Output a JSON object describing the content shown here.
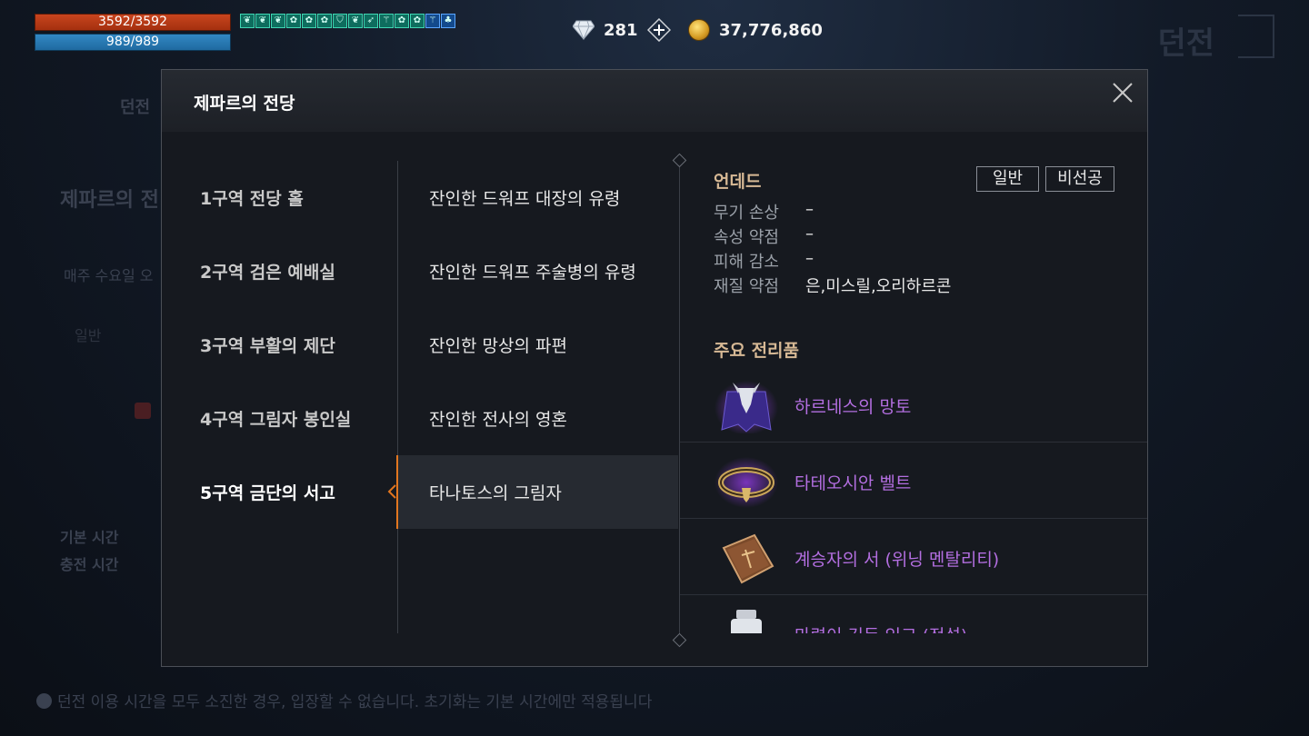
{
  "hud": {
    "hp": "3592/3592",
    "mp": "989/989",
    "buff_icons": [
      "leaf-icon",
      "leaf-icon",
      "leaf-icon",
      "flower-icon",
      "flower-icon",
      "flower-icon",
      "shield-icon",
      "leaf-icon",
      "feather-icon",
      "staff-icon",
      "flower-icon",
      "flower-icon",
      "staff-icon",
      "tree-icon"
    ]
  },
  "currency": {
    "gems": "281",
    "gold": "37,776,860"
  },
  "background": {
    "title": "던전",
    "dungeon_label": "던전",
    "sub_title": "제파르의 전",
    "weekly": "매주 수요일 오",
    "mode": "일반",
    "base_time": "기본 시간",
    "charge_time": "충전 시간",
    "note": "던전 이용 시간을 모두 소진한 경우, 입장할 수 없습니다. 초기화는 기본 시간에만 적용됩니다"
  },
  "modal": {
    "title": "제파르의 전당",
    "zones": [
      {
        "label": "1구역 전당 홀",
        "active": false
      },
      {
        "label": "2구역 검은 예배실",
        "active": false
      },
      {
        "label": "3구역 부활의 제단",
        "active": false
      },
      {
        "label": "4구역 그림자 봉인실",
        "active": false
      },
      {
        "label": "5구역 금단의 서고",
        "active": true
      }
    ],
    "bosses": [
      {
        "label": "잔인한 드워프 대장의 유령",
        "active": false
      },
      {
        "label": "잔인한 드워프 주술병의 유령",
        "active": false
      },
      {
        "label": "잔인한 망상의 파편",
        "active": false
      },
      {
        "label": "잔인한 전사의 영혼",
        "active": false
      },
      {
        "label": "타나토스의 그림자",
        "active": true
      }
    ],
    "detail": {
      "type": "언데드",
      "tags": [
        "일반",
        "비선공"
      ],
      "stats": [
        {
          "label": "무기 손상",
          "value": "–"
        },
        {
          "label": "속성 약점",
          "value": "–"
        },
        {
          "label": "피해 감소",
          "value": "–"
        },
        {
          "label": "재질 약점",
          "value": "은,미스릴,오리하르콘"
        }
      ],
      "drops_title": "주요 전리품",
      "drops": [
        {
          "name": "하르네스의 망토",
          "icon": "cloak-icon"
        },
        {
          "name": "타테오시안 벨트",
          "icon": "belt-icon"
        },
        {
          "name": "계승자의 서 (위닝 멘탈리티)",
          "icon": "book-icon"
        },
        {
          "name": "마력이 깃든 잉크 (전설)",
          "icon": "ink-bottle-icon"
        }
      ],
      "colors": {
        "rare_purple": "#b36ee0",
        "section_title": "#d7b995",
        "accent": "#e2761f"
      }
    }
  }
}
